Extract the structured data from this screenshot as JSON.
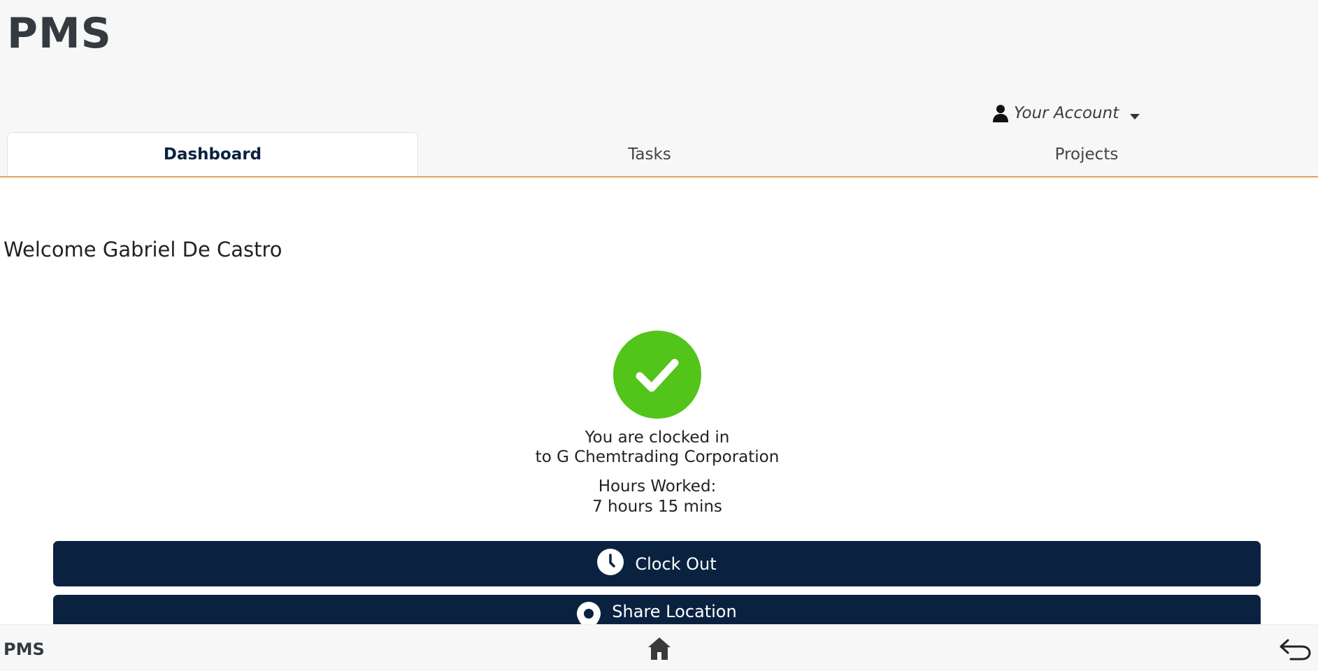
{
  "app": {
    "title": "PMS"
  },
  "header": {
    "account_label": "Your Account",
    "account_icon": "user-icon",
    "caret_icon": "caret-down-icon"
  },
  "tabs": [
    {
      "label": "Dashboard",
      "active": true
    },
    {
      "label": "Tasks",
      "active": false
    },
    {
      "label": "Projects",
      "active": false
    }
  ],
  "main": {
    "welcome": "Welcome Gabriel De Castro",
    "status_icon": "check-circle-icon",
    "status_line1": "You are clocked in",
    "status_line2": "to G Chemtrading Corporation",
    "hours_label": "Hours Worked:",
    "hours_value": "7 hours 15 mins",
    "clock_out_label": "Clock Out",
    "share_location_label": "Share Location"
  },
  "footer": {
    "brand": "PMS",
    "home_icon": "home-icon",
    "back_icon": "back-arrow-icon"
  },
  "colors": {
    "primary": "#0a2240",
    "success": "#52c41a",
    "header_bg": "#f7f7f7",
    "accent_border": "#e0a458"
  }
}
